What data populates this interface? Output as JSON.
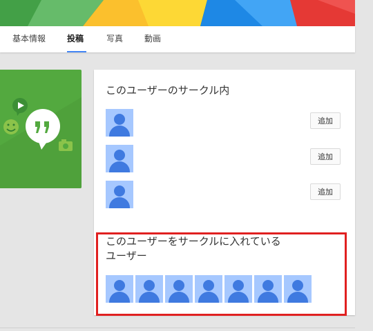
{
  "tabs": [
    {
      "label": "基本情報",
      "active": false
    },
    {
      "label": "投稿",
      "active": true
    },
    {
      "label": "写真",
      "active": false
    },
    {
      "label": "動画",
      "active": false
    }
  ],
  "hangout_card": {
    "icons": [
      "hangouts-quote-icon",
      "play-icon",
      "smiley-icon",
      "camera-icon"
    ]
  },
  "in_circles": {
    "title": "このユーザーのサークル内",
    "people": [
      {
        "avatar": "default-avatar",
        "add_label": "追加"
      },
      {
        "avatar": "default-avatar",
        "add_label": "追加"
      },
      {
        "avatar": "default-avatar",
        "add_label": "追加"
      }
    ]
  },
  "have_in_circles": {
    "title_line1": "このユーザーをサークルに入れている",
    "title_line2": "ユーザー",
    "avatar_count": 7
  },
  "colors": {
    "accent": "#4285f4",
    "hangouts_green": "#53a93f",
    "highlight": "#e02020",
    "avatar_bg": "#a6c8ff"
  }
}
